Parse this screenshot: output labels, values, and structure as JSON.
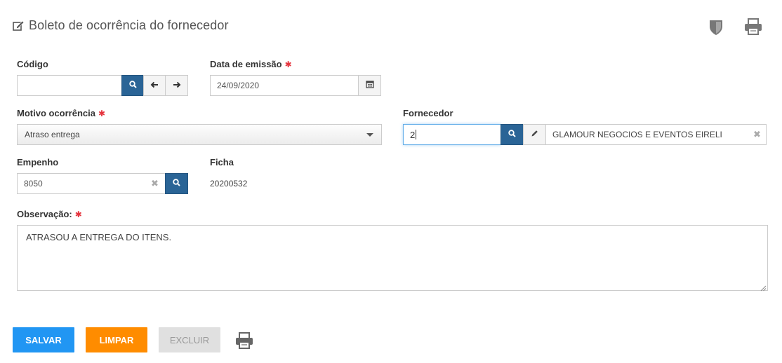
{
  "header": {
    "title": "Boleto de ocorrência do fornecedor",
    "title_icon": "edit-icon",
    "shield_icon": "shield-icon",
    "print_icon": "printer-icon"
  },
  "form": {
    "codigo": {
      "label": "Código",
      "value": ""
    },
    "data_emissao": {
      "label": "Data de emissão",
      "required_mark": "✱",
      "value": "24/09/2020"
    },
    "motivo": {
      "label": "Motivo ocorrência",
      "required_mark": "✱",
      "selected": "Atraso entrega"
    },
    "fornecedor": {
      "label": "Fornecedor",
      "code_value": "2",
      "name_value": "GLAMOUR NEGOCIOS E EVENTOS EIRELI"
    },
    "empenho": {
      "label": "Empenho",
      "value": "8050"
    },
    "ficha": {
      "label": "Ficha",
      "value": "20200532"
    },
    "observacao": {
      "label": "Observação:",
      "required_mark": "✱",
      "value": "ATRASOU A ENTREGA DO ITENS."
    }
  },
  "actions": {
    "salvar": "SALVAR",
    "limpar": "LIMPAR",
    "excluir": "EXCLUIR"
  },
  "colors": {
    "primary_blue": "#2196f3",
    "search_blue": "#2a6496",
    "orange": "#ff8c00",
    "disabled": "#e0e0e0",
    "required": "#e5333d"
  }
}
